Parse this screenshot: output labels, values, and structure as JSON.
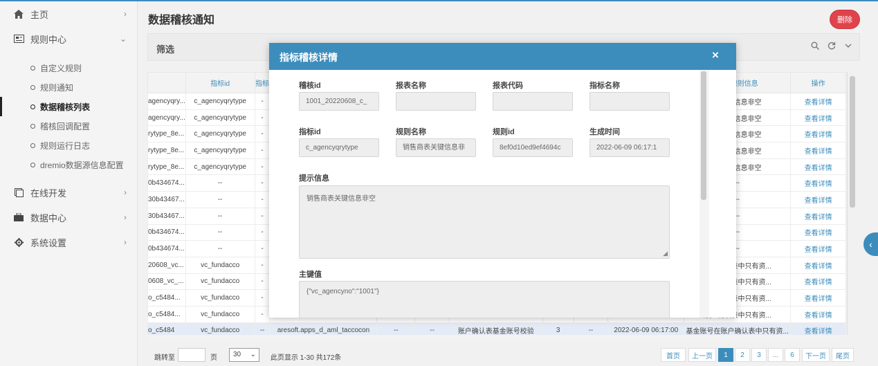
{
  "colors": {
    "accent": "#3c8dbc",
    "danger": "#e0434b",
    "highlight_row": "#e4ebf6"
  },
  "sidebar": {
    "items": [
      {
        "label": "主页",
        "icon": "home-icon"
      },
      {
        "label": "规则中心",
        "icon": "rules-icon"
      },
      {
        "label": "在线开发",
        "icon": "online-dev-icon"
      },
      {
        "label": "数据中心",
        "icon": "data-center-icon"
      },
      {
        "label": "系统设置",
        "icon": "gear-icon"
      }
    ],
    "sub_items": [
      "自定义规则",
      "规则通知",
      "数据稽核列表",
      "稽核回调配置",
      "规则运行日志",
      "dremio数据源信息配置"
    ]
  },
  "header": {
    "title": "数据稽核通知",
    "delete_label": "删除"
  },
  "filter": {
    "title": "筛选"
  },
  "table": {
    "headers": [
      "",
      "指标id",
      "指标",
      "",
      "",
      "",
      "",
      "",
      "",
      "",
      "符合规则信息",
      "操作"
    ],
    "action_label": "查看详情",
    "rows": [
      [
        "agencyqry...",
        "c_agencyqrytype",
        "-",
        "",
        "",
        "",
        "",
        "",
        "",
        "",
        "表关键信息非空"
      ],
      [
        "agencyqry...",
        "c_agencyqrytype",
        "-",
        "",
        "",
        "",
        "",
        "",
        "",
        "",
        "表关键信息非空"
      ],
      [
        "rytype_8e...",
        "c_agencyqrytype",
        "-",
        "",
        "",
        "",
        "",
        "",
        "",
        "",
        "表关键信息非空"
      ],
      [
        "rytype_8e...",
        "c_agencyqrytype",
        "-",
        "",
        "",
        "",
        "",
        "",
        "",
        "",
        "表关键信息非空"
      ],
      [
        "rytype_8e...",
        "c_agencyqrytype",
        "-",
        "",
        "",
        "",
        "",
        "",
        "",
        "",
        "表关键信息非空"
      ],
      [
        "0b434674...",
        "--",
        "-",
        "",
        "",
        "",
        "",
        "",
        "",
        "",
        "--"
      ],
      [
        "30b43467...",
        "--",
        "-",
        "",
        "",
        "",
        "",
        "",
        "",
        "",
        "--"
      ],
      [
        "30b43467...",
        "--",
        "-",
        "",
        "",
        "",
        "",
        "",
        "",
        "",
        "--"
      ],
      [
        "0b434674...",
        "--",
        "-",
        "",
        "",
        "",
        "",
        "",
        "",
        "",
        "--"
      ],
      [
        "0b434674...",
        "--",
        "-",
        "",
        "",
        "",
        "",
        "",
        "",
        "",
        "--"
      ],
      [
        "20608_vc...",
        "vc_fundacco",
        "-",
        "",
        "",
        "",
        "",
        "",
        "",
        "",
        "账户确认表中只有资..."
      ],
      [
        "0608_vc_...",
        "vc_fundacco",
        "-",
        "",
        "",
        "",
        "",
        "",
        "",
        "",
        "账户确认表中只有资..."
      ],
      [
        "o_c5484...",
        "vc_fundacco",
        "-",
        "",
        "",
        "",
        "",
        "",
        "",
        "",
        "账户确认表中只有资..."
      ],
      [
        "o_c5484...",
        "vc_fundacco",
        "-",
        "",
        "",
        "",
        "",
        "",
        "",
        "",
        "账户确认表中只有资..."
      ],
      [
        "o_c5484",
        "vc_fundacco",
        "--",
        "aresoft.apps_d_aml_taccocon",
        "--",
        "--",
        "账户确认表基金账号校验",
        "3",
        "--",
        "2022-06-09 06:17:00",
        "基金账号在账户确认表中只有资..."
      ]
    ]
  },
  "pager": {
    "jump_label": "跳转至",
    "page_unit": "页",
    "page_size": "30",
    "summary": "此页显示 1-30 共172条",
    "first": "首页",
    "prev": "上一页",
    "pages": [
      "1",
      "2",
      "3",
      "...",
      "6"
    ],
    "next": "下一页",
    "last": "尾页"
  },
  "modal": {
    "title": "指标稽核详情",
    "close": "×",
    "fields_row1": [
      {
        "label": "稽核id",
        "value": "1001_20220608_c_"
      },
      {
        "label": "报表名称",
        "value": ""
      },
      {
        "label": "报表代码",
        "value": ""
      },
      {
        "label": "指标名称",
        "value": ""
      }
    ],
    "fields_row2": [
      {
        "label": "指标id",
        "value": "c_agencyqrytype"
      },
      {
        "label": "规则名称",
        "value": "销售商表关键信息非"
      },
      {
        "label": "规则id",
        "value": "8ef0d10ed9ef4694c"
      },
      {
        "label": "生成时间",
        "value": "2022-06-09 06:17:1"
      }
    ],
    "prompt_label": "提示信息",
    "prompt_value": "销售商表关键信息非空",
    "key_label": "主键值",
    "key_value": "{\"vc_agencyno\":\"1001\"}"
  }
}
